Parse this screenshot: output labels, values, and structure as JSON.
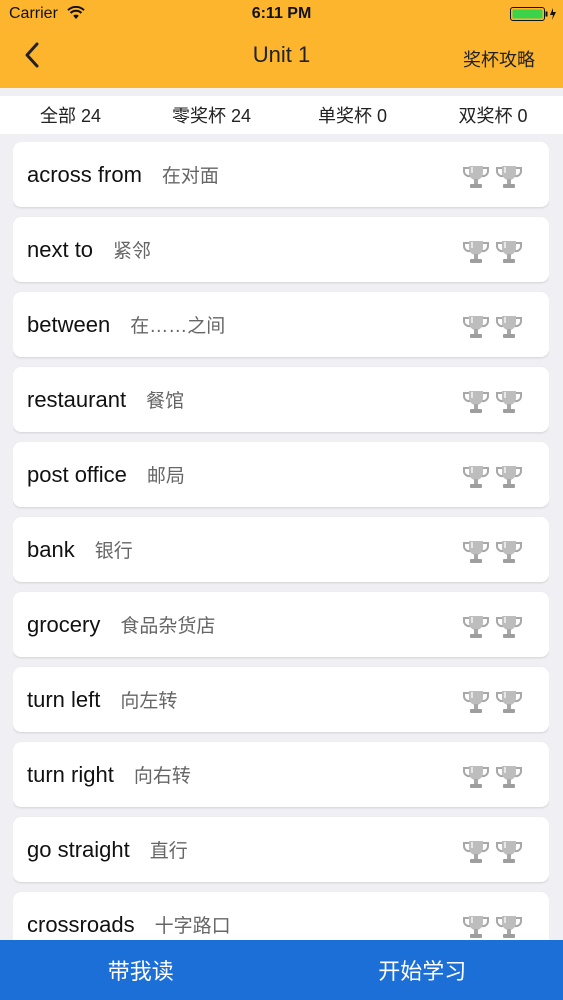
{
  "status_bar": {
    "carrier": "Carrier",
    "time": "6:11 PM"
  },
  "nav": {
    "title": "Unit 1",
    "right_label": "奖杯攻略",
    "back_icon": "chevron-left-icon"
  },
  "tabs": [
    {
      "label": "全部 24",
      "active": true
    },
    {
      "label": "零奖杯 24",
      "active": false
    },
    {
      "label": "单奖杯 0",
      "active": false
    },
    {
      "label": "双奖杯 0",
      "active": false
    }
  ],
  "words": [
    {
      "word": "across from",
      "meaning": "在对面",
      "trophies_earned": 0
    },
    {
      "word": "next to",
      "meaning": "紧邻",
      "trophies_earned": 0
    },
    {
      "word": "between",
      "meaning": "在……之间",
      "trophies_earned": 0
    },
    {
      "word": "restaurant",
      "meaning": "餐馆",
      "trophies_earned": 0
    },
    {
      "word": "post office",
      "meaning": "邮局",
      "trophies_earned": 0
    },
    {
      "word": "bank",
      "meaning": "银行",
      "trophies_earned": 0
    },
    {
      "word": "grocery",
      "meaning": "食品杂货店",
      "trophies_earned": 0
    },
    {
      "word": "turn left",
      "meaning": "向左转",
      "trophies_earned": 0
    },
    {
      "word": "turn right",
      "meaning": "向右转",
      "trophies_earned": 0
    },
    {
      "word": "go straight",
      "meaning": "直行",
      "trophies_earned": 0
    },
    {
      "word": "crossroads",
      "meaning": "十字路口",
      "trophies_earned": 0
    }
  ],
  "bottom": {
    "read_label": "带我读",
    "study_label": "开始学习"
  },
  "colors": {
    "header_bg": "#fdb52e",
    "bottom_bg": "#1c6fd6",
    "trophy_grey": "#b5b5b5"
  }
}
